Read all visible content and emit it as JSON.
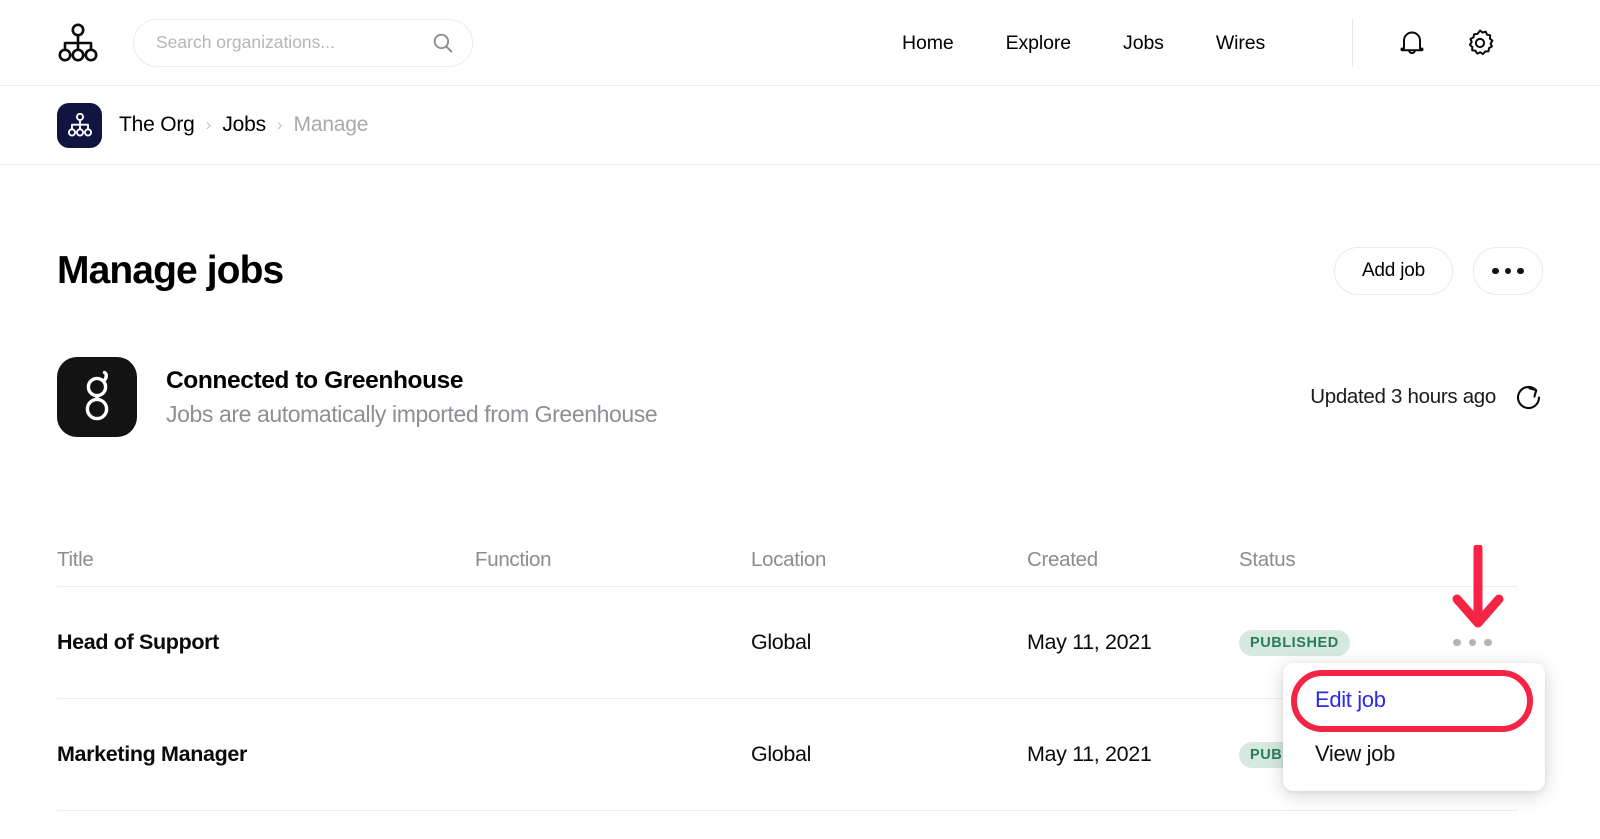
{
  "topnav": {
    "logo_icon": "org-chart-icon",
    "search": {
      "value": "",
      "placeholder": "Search organizations...",
      "icon": "search-icon"
    },
    "links": [
      {
        "label": "Home"
      },
      {
        "label": "Explore"
      },
      {
        "label": "Jobs"
      },
      {
        "label": "Wires"
      }
    ],
    "icons": [
      {
        "name": "bell-icon"
      },
      {
        "name": "gear-icon"
      }
    ]
  },
  "breadcrumb": {
    "org_icon": "org-chart-icon",
    "org_badge_color": "#0f1440",
    "items": [
      {
        "label": "The Org",
        "muted": false
      },
      {
        "label": "Jobs",
        "muted": false
      },
      {
        "label": "Manage",
        "muted": true
      }
    ],
    "separator": "›"
  },
  "main": {
    "page_title": "Manage jobs",
    "actions": {
      "add_job_label": "Add job",
      "more_icon": "ellipsis-icon"
    },
    "integration": {
      "logo_letter": "g",
      "logo_name": "greenhouse-logo",
      "title": "Connected to Greenhouse",
      "subtitle": "Jobs are automatically imported from Greenhouse",
      "updated_text": "Updated 3 hours ago",
      "refresh_icon": "refresh-icon"
    },
    "table": {
      "columns": [
        "Title",
        "Function",
        "Location",
        "Created",
        "Status"
      ],
      "rows": [
        {
          "title": "Head of Support",
          "function": "",
          "location": "Global",
          "created": "May 11, 2021",
          "status": "PUBLISHED",
          "menu_icon": "ellipsis-icon"
        },
        {
          "title": "Marketing Manager",
          "function": "",
          "location": "Global",
          "created": "May 11, 2021",
          "status": "PUBLISHED",
          "menu_icon": "ellipsis-icon"
        }
      ],
      "status_badge_bg": "#d6e9e0",
      "status_badge_color": "#2c7b5e"
    },
    "dropdown": {
      "items": [
        {
          "label": "Edit job",
          "highlighted": true
        },
        {
          "label": "View job",
          "highlighted": false
        }
      ]
    },
    "annotations": {
      "arrow_color": "#f52444",
      "highlight_color": "#f52444"
    }
  }
}
